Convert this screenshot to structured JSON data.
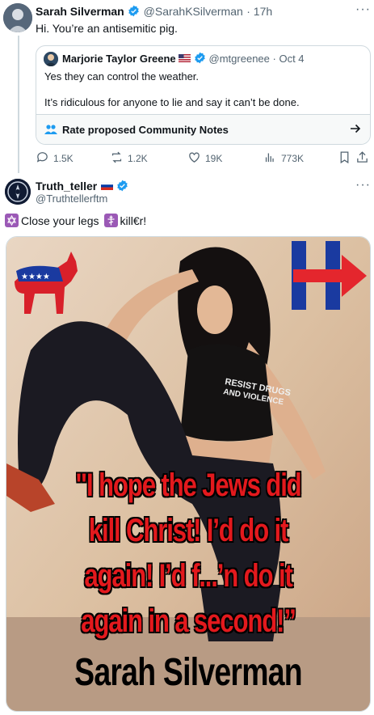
{
  "reply_tweet": {
    "author_name": "Sarah Silverman",
    "author_handle": "@SarahKSilverman",
    "timestamp": "· 17h",
    "text": "Hi. You’re an antisemitic pig."
  },
  "quoted_tweet": {
    "author_name": "Marjorie Taylor Greene",
    "author_handle": "@mtgreenee",
    "timestamp": "· Oct 4",
    "line1": "Yes they can control the weather.",
    "line2": "It’s ridiculous for anyone to lie and say it can’t be done.",
    "community_notes_label": "Rate proposed Community Notes"
  },
  "actions": {
    "replies": "1.5K",
    "reposts": "1.2K",
    "likes": "19K",
    "views": "773K"
  },
  "second_tweet": {
    "author_name": "Truth_teller",
    "author_handle": "@Truthtellerftm",
    "text_part1": "Close your legs",
    "text_part2": "kill€r!"
  },
  "meme": {
    "line1": "\"I hope the Jews did",
    "line2": "kill Christ! I’d do it",
    "line3": "again! I’d f...’n do it",
    "line4": "again in a second!”",
    "signature": "Sarah Silverman",
    "shirt_text1": "RESIST DRUGS",
    "shirt_text2": "AND VIOLENCE"
  },
  "colors": {
    "accent": "#1d9bf0",
    "meme_red": "#e3191d",
    "democrat_blue": "#1a3aa0",
    "hillary_red": "#e4262d"
  },
  "icons": [
    "verified-icon",
    "more-icon",
    "reply-icon",
    "repost-icon",
    "like-icon",
    "views-icon",
    "bookmark-icon",
    "share-icon",
    "community-notes-icon",
    "arrow-right-icon",
    "star-of-david-icon",
    "orthodox-cross-icon",
    "us-flag-icon",
    "russia-flag-icon"
  ]
}
